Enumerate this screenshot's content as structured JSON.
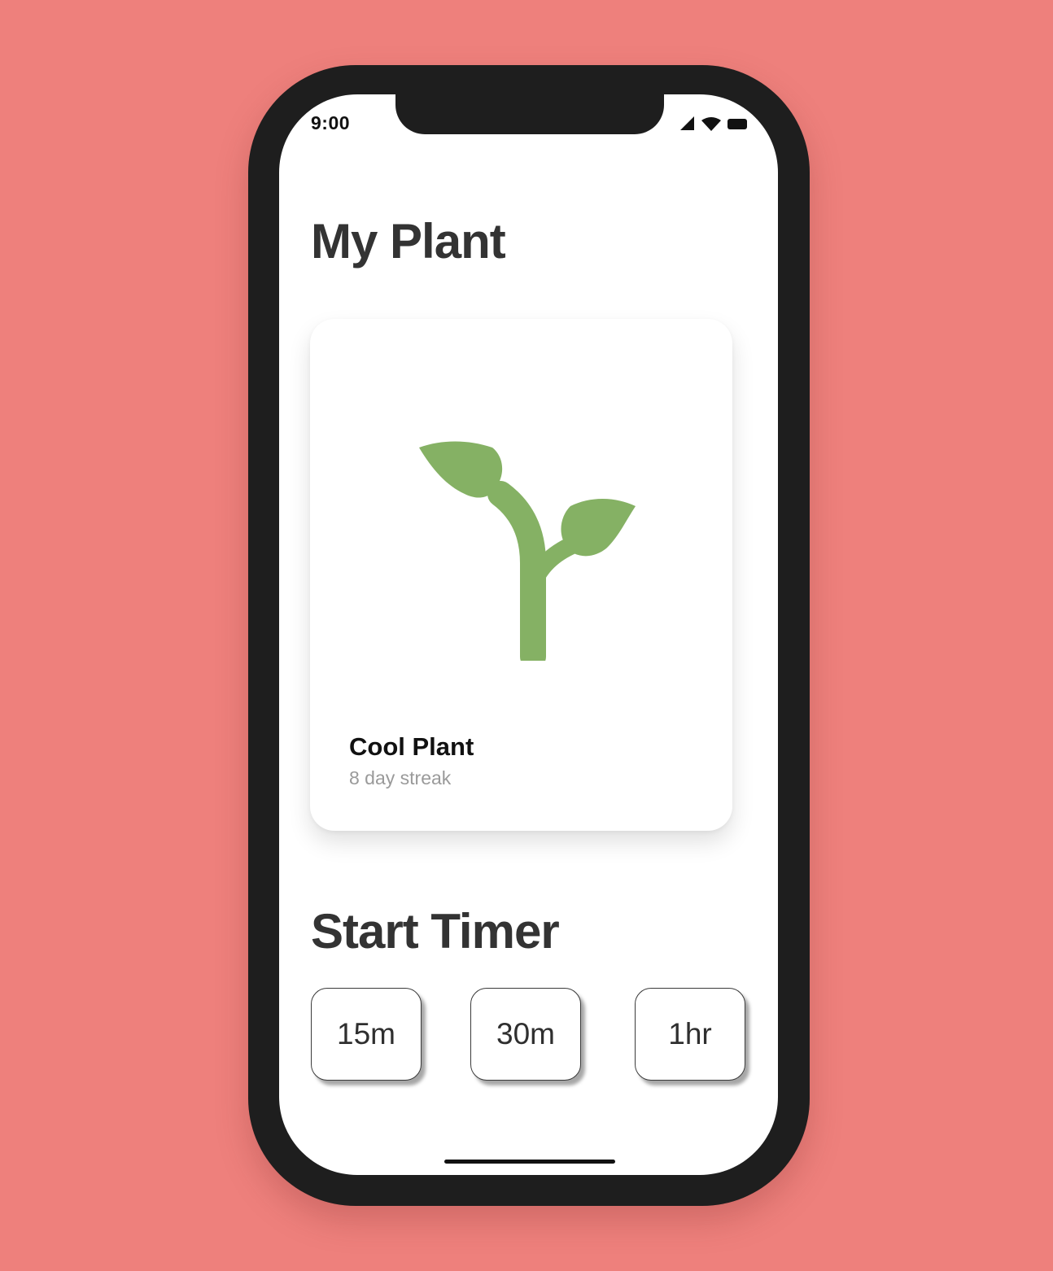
{
  "status_bar": {
    "time": "9:00",
    "icons": [
      "signal-icon",
      "wifi-icon",
      "battery-icon"
    ]
  },
  "main": {
    "title": "My Plant",
    "plant_card": {
      "image": "seedling-icon",
      "name": "Cool Plant",
      "streak": "8 day streak"
    },
    "timer": {
      "title": "Start Timer",
      "options": [
        "15m",
        "30m",
        "1hr"
      ]
    }
  },
  "colors": {
    "background": "#ee807c",
    "phone_frame": "#1e1e1e",
    "plant_green": "#85b164",
    "heading_text": "#333333",
    "subtle_text": "#9a9a9a"
  }
}
